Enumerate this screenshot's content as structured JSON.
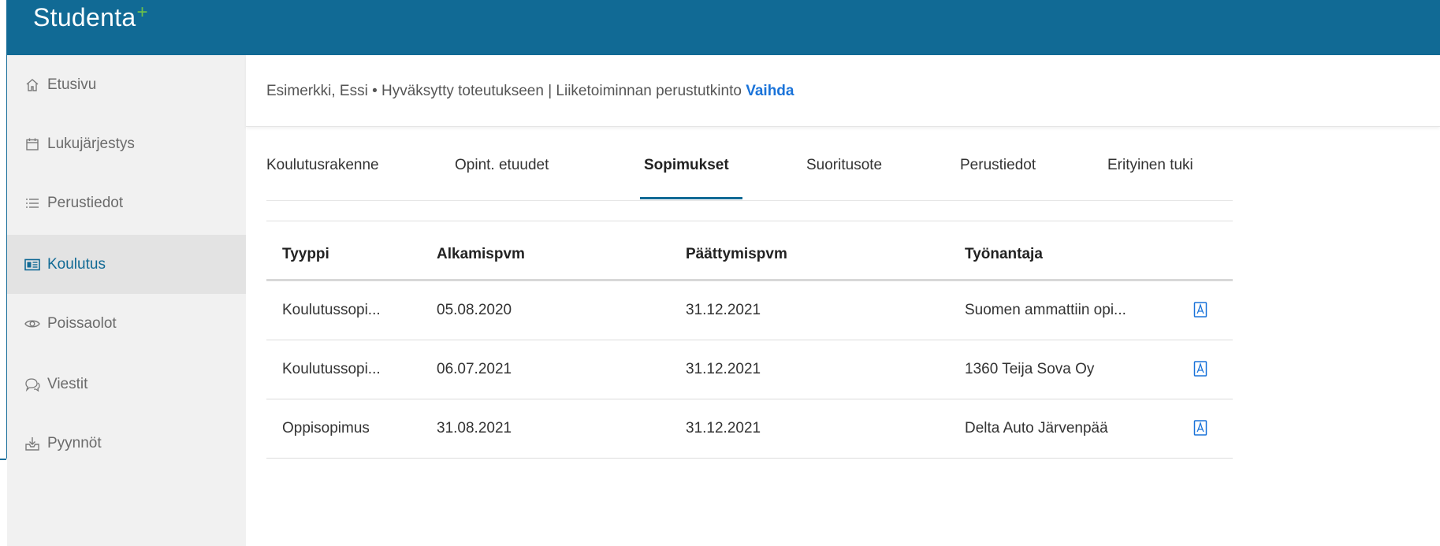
{
  "app": {
    "logo_text": "Studenta",
    "logo_plus": "+"
  },
  "sidebar": {
    "items": [
      {
        "label": "Etusivu",
        "icon": "home-icon"
      },
      {
        "label": "Lukujärjestys",
        "icon": "calendar-icon"
      },
      {
        "label": "Perustiedot",
        "icon": "list-icon"
      },
      {
        "label": "Koulutus",
        "icon": "id-card-icon",
        "active": true
      },
      {
        "label": "Poissaolot",
        "icon": "eye-icon"
      },
      {
        "label": "Viestit",
        "icon": "chat-icon"
      },
      {
        "label": "Pyynnöt",
        "icon": "inbox-icon"
      }
    ]
  },
  "student_bar": {
    "text": "Esimerkki, Essi • Hyväksytty toteutukseen | Liiketoiminnan perustutkinto",
    "link": "Vaihda"
  },
  "tabs": [
    {
      "label": "Koulutusrakenne"
    },
    {
      "label": "Opint. etuudet"
    },
    {
      "label": "Sopimukset",
      "active": true
    },
    {
      "label": "Suoritusote"
    },
    {
      "label": "Perustiedot"
    },
    {
      "label": "Erityinen tuki"
    }
  ],
  "table": {
    "headers": [
      "Tyyppi",
      "Alkamispvm",
      "Päättymispvm",
      "Työnantaja"
    ],
    "rows": [
      [
        "Koulutussopi...",
        "05.08.2020",
        "31.12.2021",
        "Suomen ammattiin opi..."
      ],
      [
        "Koulutussopi...",
        "06.07.2021",
        "31.12.2021",
        "1360 Teija Sova Oy"
      ],
      [
        "Oppisopimus",
        "31.08.2021",
        "31.12.2021",
        "Delta Auto Järvenpää"
      ]
    ],
    "row_icon": "pdf-icon"
  },
  "colors": {
    "header": "#116a95",
    "link": "#1a73d9",
    "logo_plus": "#6cc04a",
    "pdf_icon": "#1a73d9"
  }
}
